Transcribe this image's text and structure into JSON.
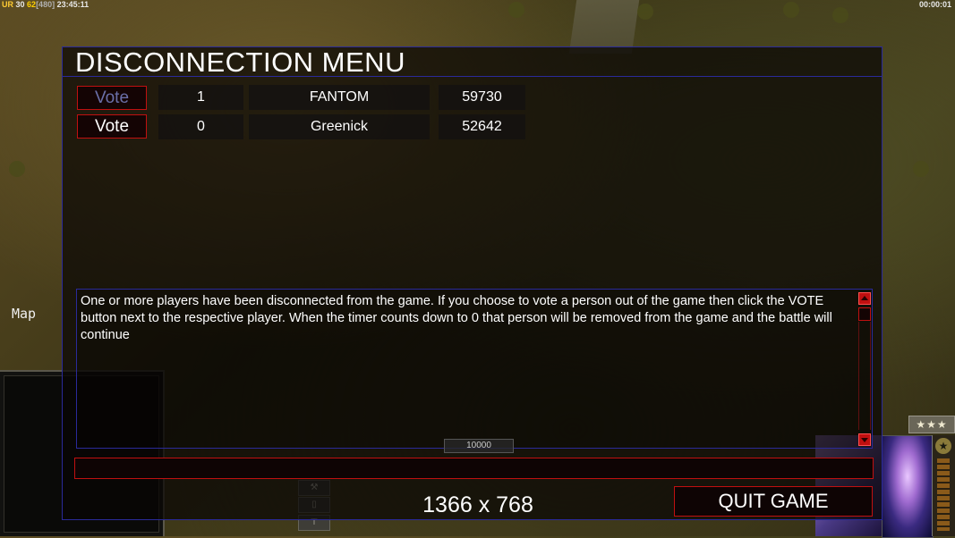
{
  "hud": {
    "ur_label": "UR",
    "ur_value": "30",
    "fps": "62",
    "latency": "[480]",
    "clock": "23:45:11",
    "game_timer": "00:00:01"
  },
  "sidebar": {
    "map_label": "Map"
  },
  "rank": {
    "stars": "★★★"
  },
  "menu": {
    "title": "DISCONNECTION MENU",
    "players": [
      {
        "vote_label": "Vote",
        "votes": "1",
        "name": "FANTOM",
        "timer": "59730",
        "vote_enabled": false
      },
      {
        "vote_label": "Vote",
        "votes": "0",
        "name": "Greenick",
        "timer": "52642",
        "vote_enabled": true
      }
    ],
    "message": "One or more players have been disconnected from the game. If you choose to vote a person out of the game then click the VOTE button next to the respective player. When the timer counts down to 0 that person will be removed from the game and the battle will continue",
    "chat_value": "",
    "countdown": "10000",
    "resolution_text": "1366 x 768",
    "quit_label": "QUIT GAME"
  },
  "colors": {
    "accent_red": "#c01010",
    "frame_blue": "#2a2a9a",
    "disabled_text": "#6a6fa8"
  }
}
